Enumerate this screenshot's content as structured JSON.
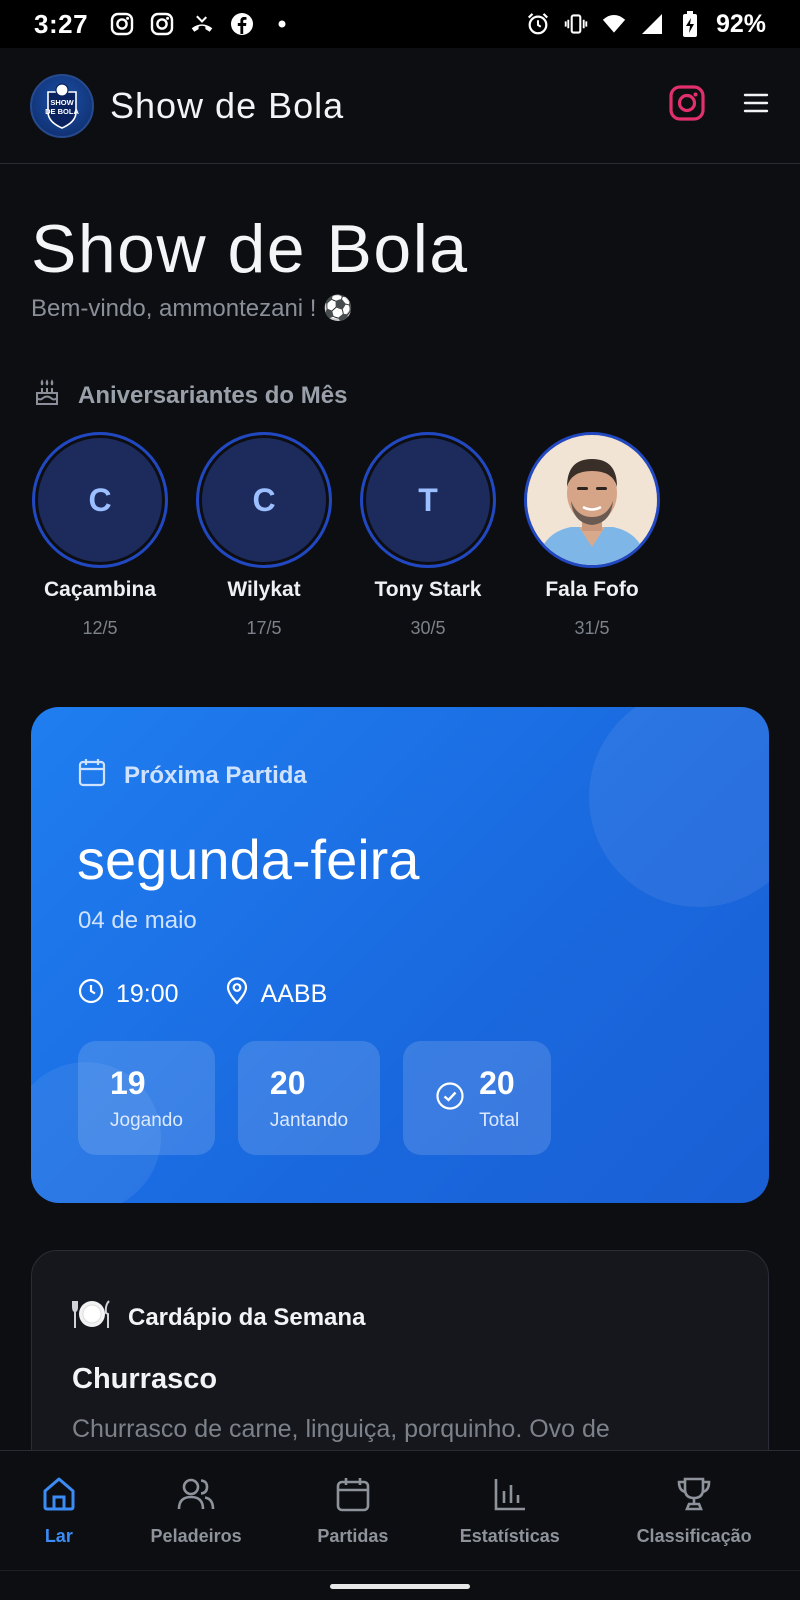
{
  "status_bar": {
    "time": "3:27",
    "battery": "92%",
    "left_icons": [
      "instagram-icon",
      "instagram-icon",
      "missed-call-icon",
      "facebook-icon",
      "dot-icon"
    ],
    "right_icons": [
      "alarm-icon",
      "vibrate-icon",
      "wifi-icon",
      "signal-icon",
      "battery-charging-icon"
    ]
  },
  "header": {
    "title": "Show de Bola",
    "logo_text": "SHOW DE BOLA",
    "instagram_color": "#e1306c"
  },
  "welcome": {
    "title": "Show de Bola",
    "subtitle": "Bem-vindo, ammontezani ! ⚽"
  },
  "birthdays": {
    "heading": "Aniversariantes do Mês",
    "people": [
      {
        "initial": "C",
        "name": "Caçambina",
        "date": "12/5"
      },
      {
        "initial": "C",
        "name": "Wilykat",
        "date": "17/5"
      },
      {
        "initial": "T",
        "name": "Tony Stark",
        "date": "30/5"
      },
      {
        "initial": "",
        "name": "Fala Fofo",
        "date": "31/5",
        "photo": "man-portrait-photo"
      }
    ]
  },
  "next_match": {
    "heading": "Próxima Partida",
    "weekday": "segunda-feira",
    "date": "04 de maio",
    "time": "19:00",
    "location": "AABB",
    "stats": [
      {
        "value": "19",
        "label": "Jogando"
      },
      {
        "value": "20",
        "label": "Jantando"
      },
      {
        "value": "20",
        "label": "Total"
      }
    ],
    "accent": "#1f7ef0"
  },
  "menu": {
    "heading": "Cardápio da Semana",
    "title": "Churrasco",
    "text": "Churrasco de carne, linguiça, porquinho. Ovo de"
  },
  "nav": {
    "items": [
      {
        "label": "Lar",
        "icon": "home-icon",
        "active": true
      },
      {
        "label": "Peladeiros",
        "icon": "users-icon"
      },
      {
        "label": "Partidas",
        "icon": "calendar-icon"
      },
      {
        "label": "Estatísticas",
        "icon": "bar-chart-icon"
      },
      {
        "label": "Classificação",
        "icon": "trophy-icon"
      }
    ],
    "active_color": "#3b8cf5"
  }
}
